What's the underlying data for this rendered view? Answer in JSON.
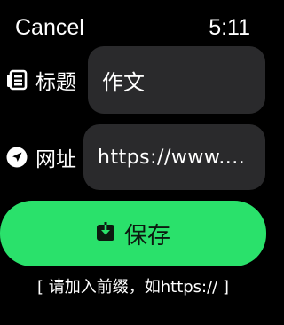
{
  "status_bar": {
    "cancel_label": "Cancel",
    "time": "5:11"
  },
  "form": {
    "title_field": {
      "label": "标题",
      "icon": "document-list-icon",
      "value": "作文"
    },
    "url_field": {
      "label": "网址",
      "icon": "location-arrow-icon",
      "value": "https://www...."
    }
  },
  "save_button": {
    "label": "保存",
    "icon": "download-icon",
    "color": "#2ae16b"
  },
  "hint_text": "[ 请加入前缀，如https:// ]"
}
